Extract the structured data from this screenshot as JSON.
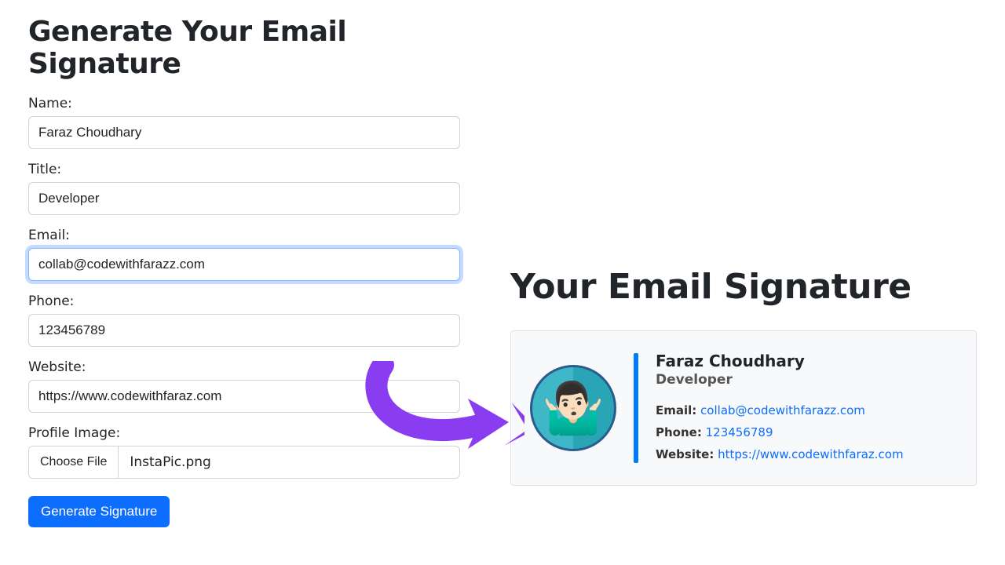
{
  "form": {
    "heading": "Generate Your Email Signature",
    "name_label": "Name:",
    "name_value": "Faraz Choudhary",
    "title_label": "Title:",
    "title_value": "Developer",
    "email_label": "Email:",
    "email_value": "collab@codewithfarazz.com",
    "phone_label": "Phone:",
    "phone_value": "123456789",
    "website_label": "Website:",
    "website_value": "https://www.codewithfaraz.com",
    "image_label": "Profile Image:",
    "choose_file_label": "Choose File",
    "file_name": "InstaPic.png",
    "generate_button": "Generate Signature"
  },
  "preview": {
    "heading": "Your Email Signature",
    "name": "Faraz Choudhary",
    "title": "Developer",
    "email_label": "Email:",
    "email": "collab@codewithfarazz.com",
    "phone_label": "Phone:",
    "phone": "123456789",
    "website_label": "Website:",
    "website": "https://www.codewithfaraz.com",
    "avatar_emoji": "🤷🏻‍♂️"
  },
  "colors": {
    "primary": "#0d6efd",
    "arrow": "#8a3cf0"
  }
}
